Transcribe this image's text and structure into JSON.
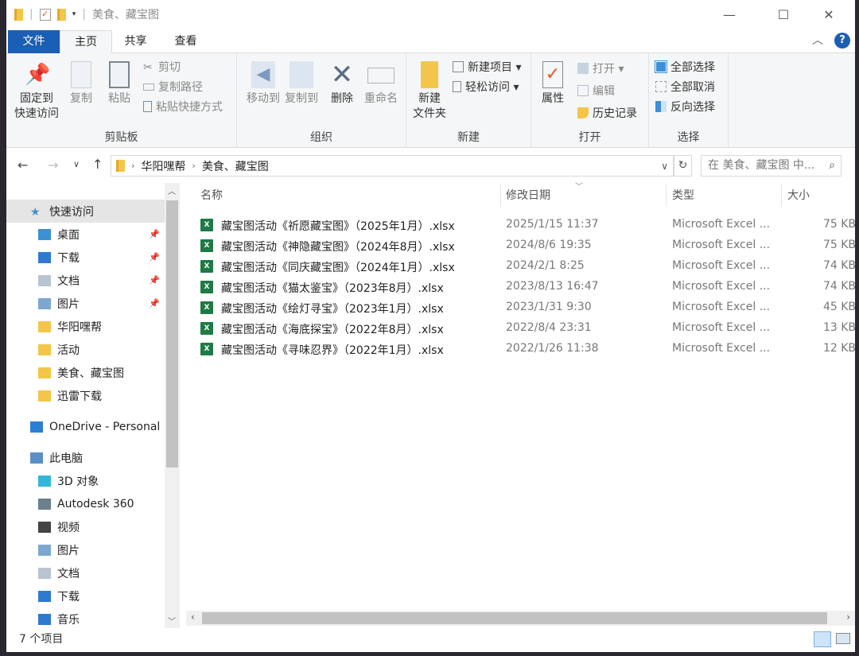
{
  "window": {
    "title": "美食、藏宝图",
    "minimize": "—",
    "maximize": "☐",
    "close": "✕"
  },
  "tabs": [
    {
      "label": "文件"
    },
    {
      "label": "主页"
    },
    {
      "label": "共享"
    },
    {
      "label": "查看"
    }
  ],
  "ribbon": {
    "clipboard": {
      "label": "剪贴板",
      "pin": "固定到\n快速访问",
      "pin1": "固定到",
      "pin2": "快速访问",
      "copy": "复制",
      "paste": "粘贴",
      "cut": "剪切",
      "copy_path": "复制路径",
      "paste_shortcut": "粘贴快捷方式"
    },
    "organize": {
      "label": "组织",
      "move_to": "移动到",
      "copy_to": "复制到",
      "delete": "删除",
      "rename": "重命名"
    },
    "new": {
      "label": "新建",
      "new_folder1": "新建",
      "new_folder2": "文件夹",
      "new_item": "新建项目 ▾",
      "easy_access": "轻松访问 ▾"
    },
    "open": {
      "label": "打开",
      "properties": "属性",
      "open": "打开 ▾",
      "edit": "编辑",
      "history": "历史记录"
    },
    "select": {
      "label": "选择",
      "select_all": "全部选择",
      "select_none": "全部取消",
      "invert": "反向选择"
    }
  },
  "address": {
    "crumbs": [
      "华阳嘿帮",
      "美食、藏宝图"
    ],
    "search_placeholder": "在 美食、藏宝图 中..."
  },
  "nav": [
    {
      "label": "快速访问",
      "icon": "star-icon",
      "selected": true
    },
    {
      "label": "桌面",
      "icon": "desktop-icon",
      "pinned": true
    },
    {
      "label": "下载",
      "icon": "download-icon",
      "pinned": true
    },
    {
      "label": "文档",
      "icon": "document-icon",
      "pinned": true
    },
    {
      "label": "图片",
      "icon": "pictures-icon",
      "pinned": true
    },
    {
      "label": "华阳嘿帮",
      "icon": "folder-icon"
    },
    {
      "label": "活动",
      "icon": "folder-icon"
    },
    {
      "label": "美食、藏宝图",
      "icon": "folder-icon"
    },
    {
      "label": "迅雷下载",
      "icon": "folder-icon"
    },
    {
      "label": "OneDrive - Personal",
      "icon": "cloud-icon"
    },
    {
      "label": "此电脑",
      "icon": "computer-icon"
    },
    {
      "label": "3D 对象",
      "icon": "3d-objects-icon"
    },
    {
      "label": "Autodesk 360",
      "icon": "autodesk-icon"
    },
    {
      "label": "视频",
      "icon": "video-icon"
    },
    {
      "label": "图片",
      "icon": "pictures-icon"
    },
    {
      "label": "文档",
      "icon": "document-icon"
    },
    {
      "label": "下载",
      "icon": "download-icon"
    },
    {
      "label": "音乐",
      "icon": "music-icon"
    }
  ],
  "columns": {
    "name": "名称",
    "modified": "修改日期",
    "type": "类型",
    "size": "大小"
  },
  "files": [
    {
      "name": "藏宝图活动《祈愿藏宝图》（2025年1月）.xlsx",
      "modified": "2025/1/15 11:37",
      "type": "Microsoft Excel ...",
      "size": "75 KB"
    },
    {
      "name": "藏宝图活动《神隐藏宝图》（2024年8月）.xlsx",
      "modified": "2024/8/6 19:35",
      "type": "Microsoft Excel ...",
      "size": "75 KB"
    },
    {
      "name": "藏宝图活动《同庆藏宝图》（2024年1月）.xlsx",
      "modified": "2024/2/1 8:25",
      "type": "Microsoft Excel ...",
      "size": "74 KB"
    },
    {
      "name": "藏宝图活动《猫太鉴宝》（2023年8月）.xlsx",
      "modified": "2023/8/13 16:47",
      "type": "Microsoft Excel ...",
      "size": "74 KB"
    },
    {
      "name": "藏宝图活动《绘灯寻宝》（2023年1月）.xlsx",
      "modified": "2023/1/31 9:30",
      "type": "Microsoft Excel ...",
      "size": "45 KB"
    },
    {
      "name": "藏宝图活动《海底探宝》（2022年8月）.xlsx",
      "modified": "2022/8/4 23:31",
      "type": "Microsoft Excel ...",
      "size": "13 KB"
    },
    {
      "name": "藏宝图活动《寻味忍界》（2022年1月）.xlsx",
      "modified": "2022/1/26 11:38",
      "type": "Microsoft Excel ...",
      "size": "12 KB"
    }
  ],
  "status": {
    "count": "7 个项目"
  }
}
